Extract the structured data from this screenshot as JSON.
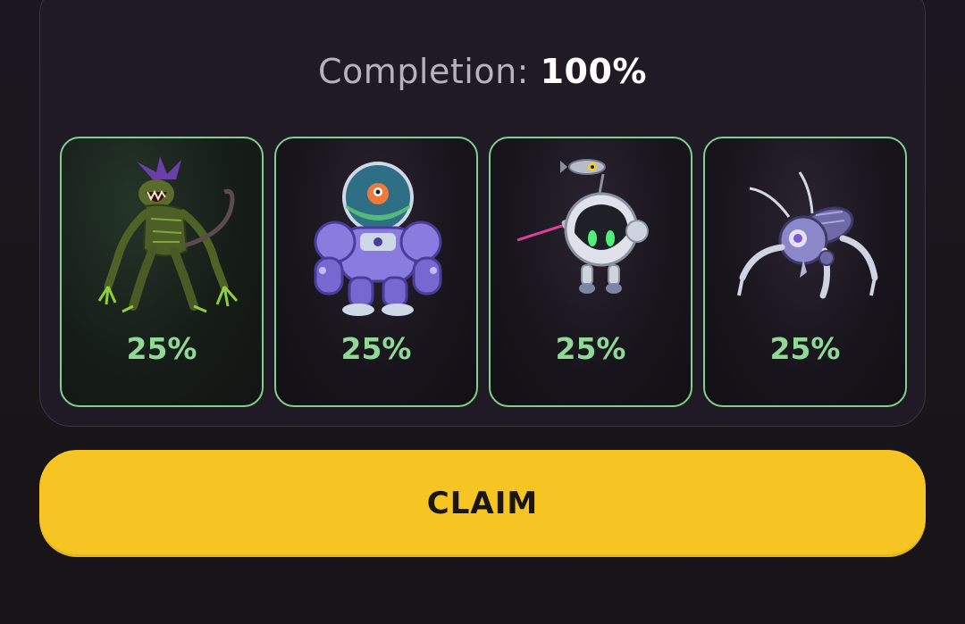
{
  "completion": {
    "label": "Completion:",
    "value": "100%"
  },
  "cards": [
    {
      "icon": "mutant-creature-icon",
      "percent": "25%"
    },
    {
      "icon": "diving-suit-robot-icon",
      "percent": "25%"
    },
    {
      "icon": "orb-drone-robot-icon",
      "percent": "25%"
    },
    {
      "icon": "spider-bot-icon",
      "percent": "25%"
    }
  ],
  "claim_button": {
    "label": "CLAIM"
  },
  "colors": {
    "accent_green": "#8fd895",
    "claim_yellow": "#f6c423",
    "background": "#1b1620"
  }
}
